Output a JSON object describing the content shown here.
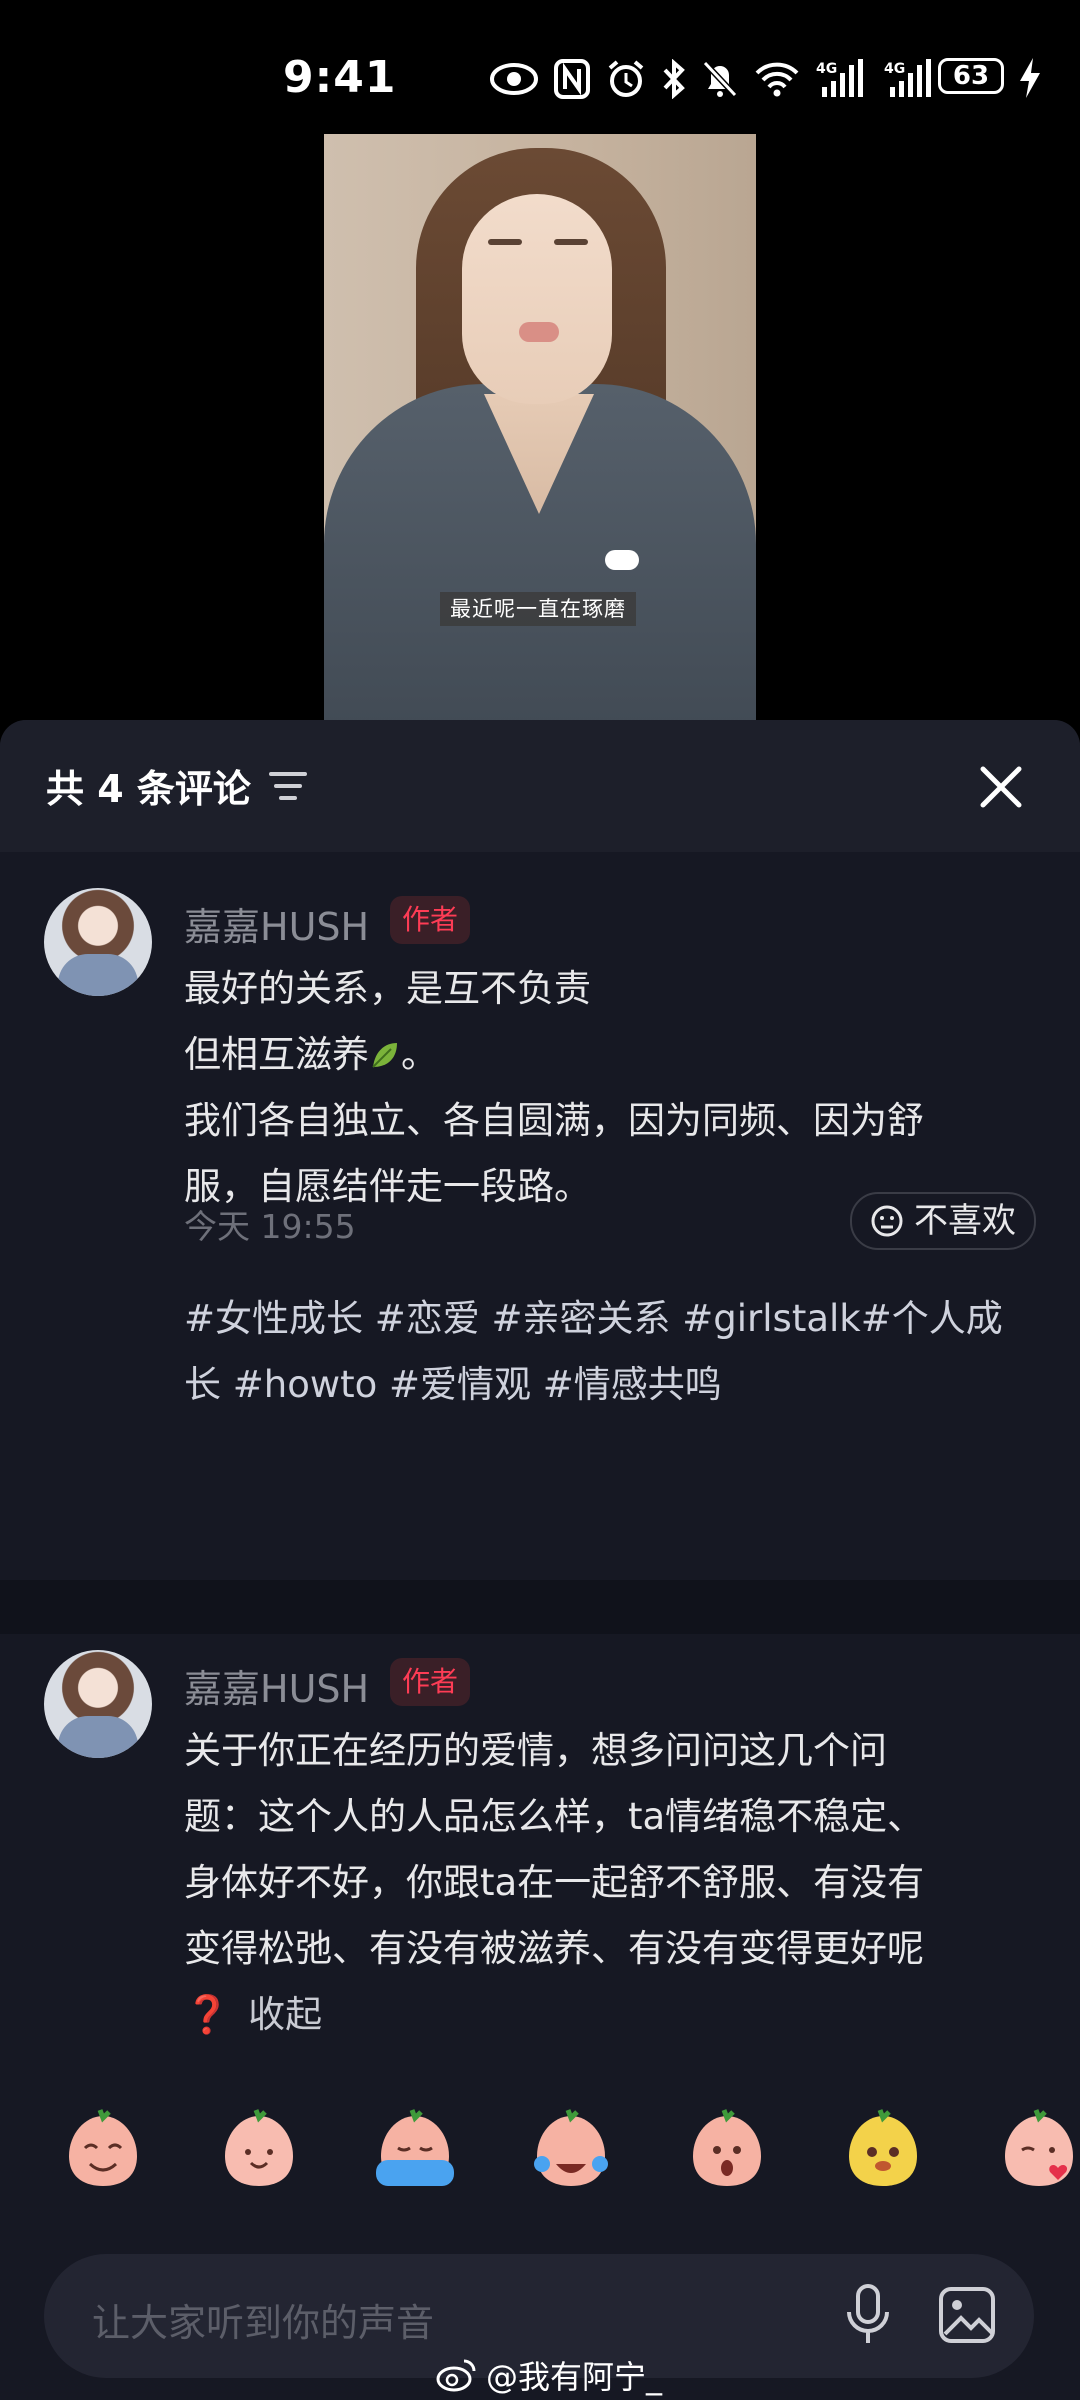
{
  "status": {
    "time": "9:41",
    "signal_1": "4G",
    "signal_2": "4G",
    "battery": "63",
    "icons": [
      "eye-icon",
      "nfc-icon",
      "alarm-icon",
      "bluetooth-icon",
      "mute-bell-icon",
      "wifi-icon",
      "signal-icon",
      "signal-icon",
      "battery-icon",
      "charging-icon"
    ]
  },
  "video": {
    "caption": "最近呢一直在琢磨"
  },
  "comments_header": {
    "title": "共 4 条评论"
  },
  "comments": [
    {
      "user": "嘉嘉HUSH",
      "badge": "作者",
      "line1": "最好的关系，是互不负责",
      "line2a": "但相互滋养",
      "line2b": "。",
      "line3": "我们各自独立、各自圆满，因为同频、因为舒",
      "line4": "服，自愿结伴走一段路。",
      "tags1": "#女性成长 #恋爱 #亲密关系 #girlstalk#个人成",
      "tags2": "长 #howto #爱情观 #情感共鸣",
      "time": "今天 19:55",
      "dislike": "不喜欢"
    },
    {
      "user": "嘉嘉HUSH",
      "badge": "作者",
      "line1": "关于你正在经历的爱情，想多问问这几个问",
      "line2": "题：这个人的人品怎么样，ta情绪稳不稳定、",
      "line3": "身体好不好，你跟ta在一起舒不舒服、有没有",
      "line4": "变得松弛、有没有被滋养、有没有变得更好呢",
      "collapse": "收起"
    }
  ],
  "emoji_bar": [
    "shy-emoji",
    "smile-emoji",
    "cry-bath-emoji",
    "tears-joy-emoji",
    "surprised-emoji",
    "dog-emoji",
    "kiss-emoji"
  ],
  "input": {
    "placeholder": "让大家听到你的声音"
  },
  "watermark": "@我有阿宁_",
  "colors": {
    "sheet_bg": "#161823",
    "badge_text": "#fe3c55",
    "badge_bg": "#3a1f27"
  }
}
